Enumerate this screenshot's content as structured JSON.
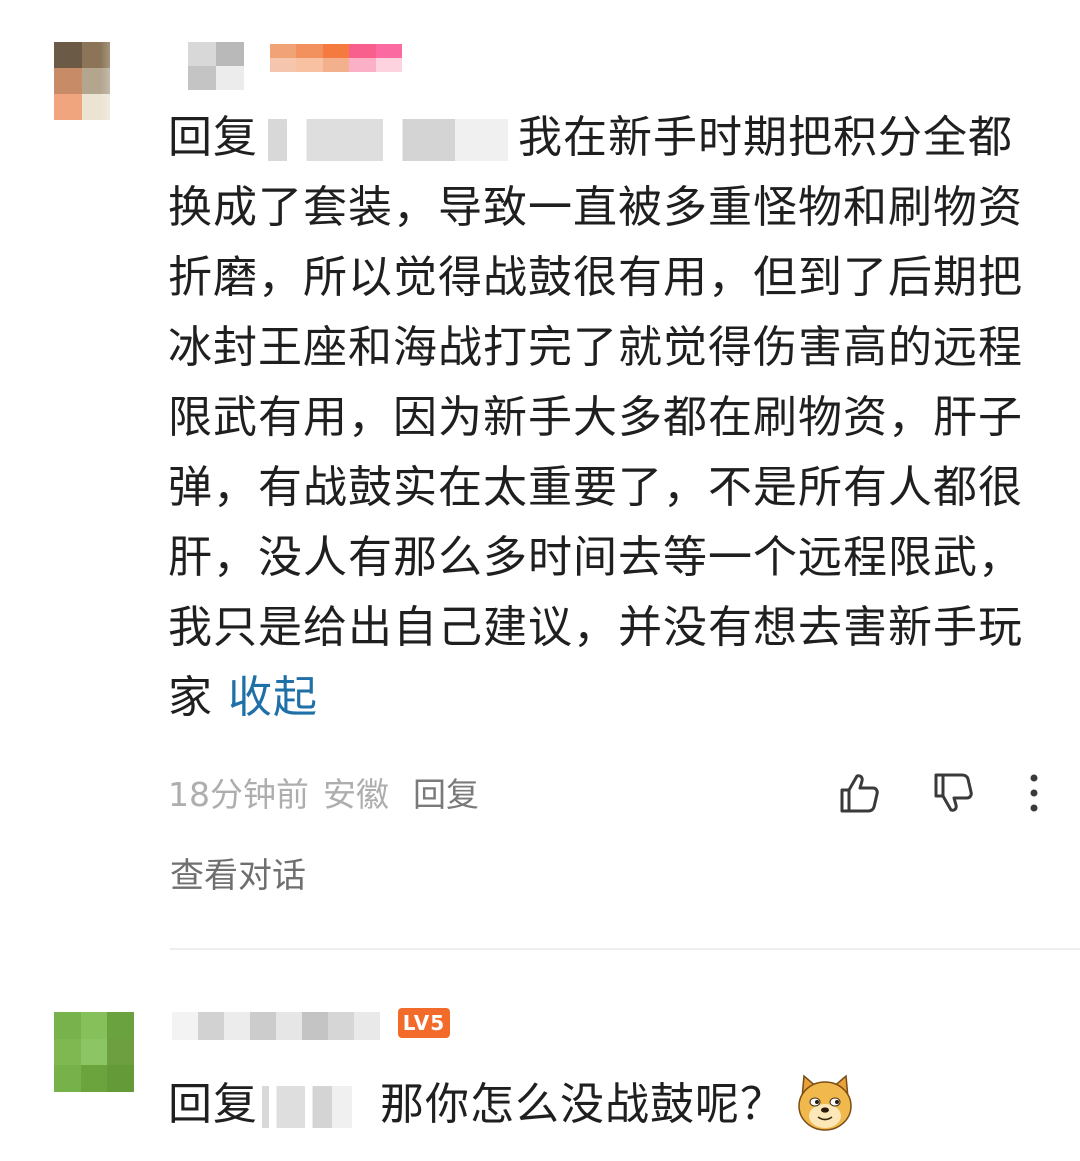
{
  "comments": [
    {
      "reply_prefix": "回复",
      "text": "我在新手时期把积分全都换成了套装，导致一直被多重怪物和刷物资折磨，所以觉得战鼓很有用，但到了后期把冰封王座和海战打完了就觉得伤害高的远程限武有用，因为新手大多都在刷物资，肝子弹，有战鼓实在太重要了，不是所有人都很肝，没人有那么多时间去等一个远程限武，我只是给出自己建议，并没有想去害新手玩家",
      "collapse_label": "收起",
      "time": "18分钟前",
      "location": "安徽",
      "reply_label": "回复",
      "view_dialog_label": "查看对话"
    },
    {
      "reply_prefix": "回复",
      "text": "那你怎么没战鼓呢？",
      "level_badge": "LV5",
      "emoji_icon": "doge-emoji-icon"
    }
  ],
  "icons": {
    "like": "thumbs-up-icon",
    "dislike": "thumbs-down-icon",
    "more": "more-vertical-icon"
  },
  "colors": {
    "accent_link": "#1f6fa8",
    "meta_text": "#aeaeae",
    "level_badge": "#f26b2b"
  }
}
